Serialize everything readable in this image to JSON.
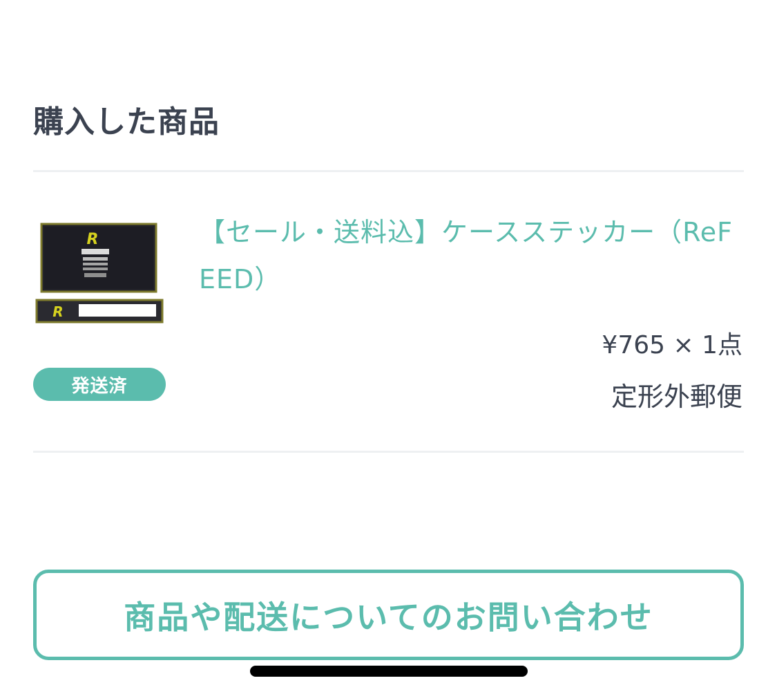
{
  "section": {
    "title": "購入した商品"
  },
  "item": {
    "name": "【セール・送料込】ケースステッカー（ReFEED）",
    "status": "発送済",
    "price_line": "¥765 × 1点",
    "shipping_method": "定形外郵便",
    "image_logo_text": "R"
  },
  "actions": {
    "contact_label": "商品や配送についてのお問い合わせ"
  },
  "colors": {
    "accent": "#5bbcad",
    "text": "#3b4250",
    "divider": "#eef0f2"
  }
}
